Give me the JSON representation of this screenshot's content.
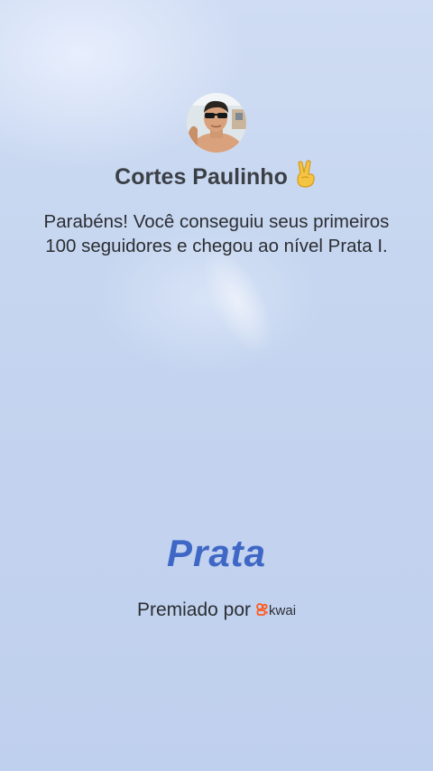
{
  "profile": {
    "name": "Cortes Paulinho",
    "emoji_icon": "victory-hand-icon"
  },
  "message": "Parabéns! Você conseguiu seus primeiros 100 seguidores e chegou ao nível Prata I.",
  "level": "Prata",
  "footer": {
    "awarded_by": "Premiado por",
    "brand_name": "kwai",
    "brand_icon": "kwai-logo-icon"
  },
  "colors": {
    "level": "#3f67c5",
    "kwai_orange": "#ff5a1f",
    "background": "#c6d6f0"
  }
}
